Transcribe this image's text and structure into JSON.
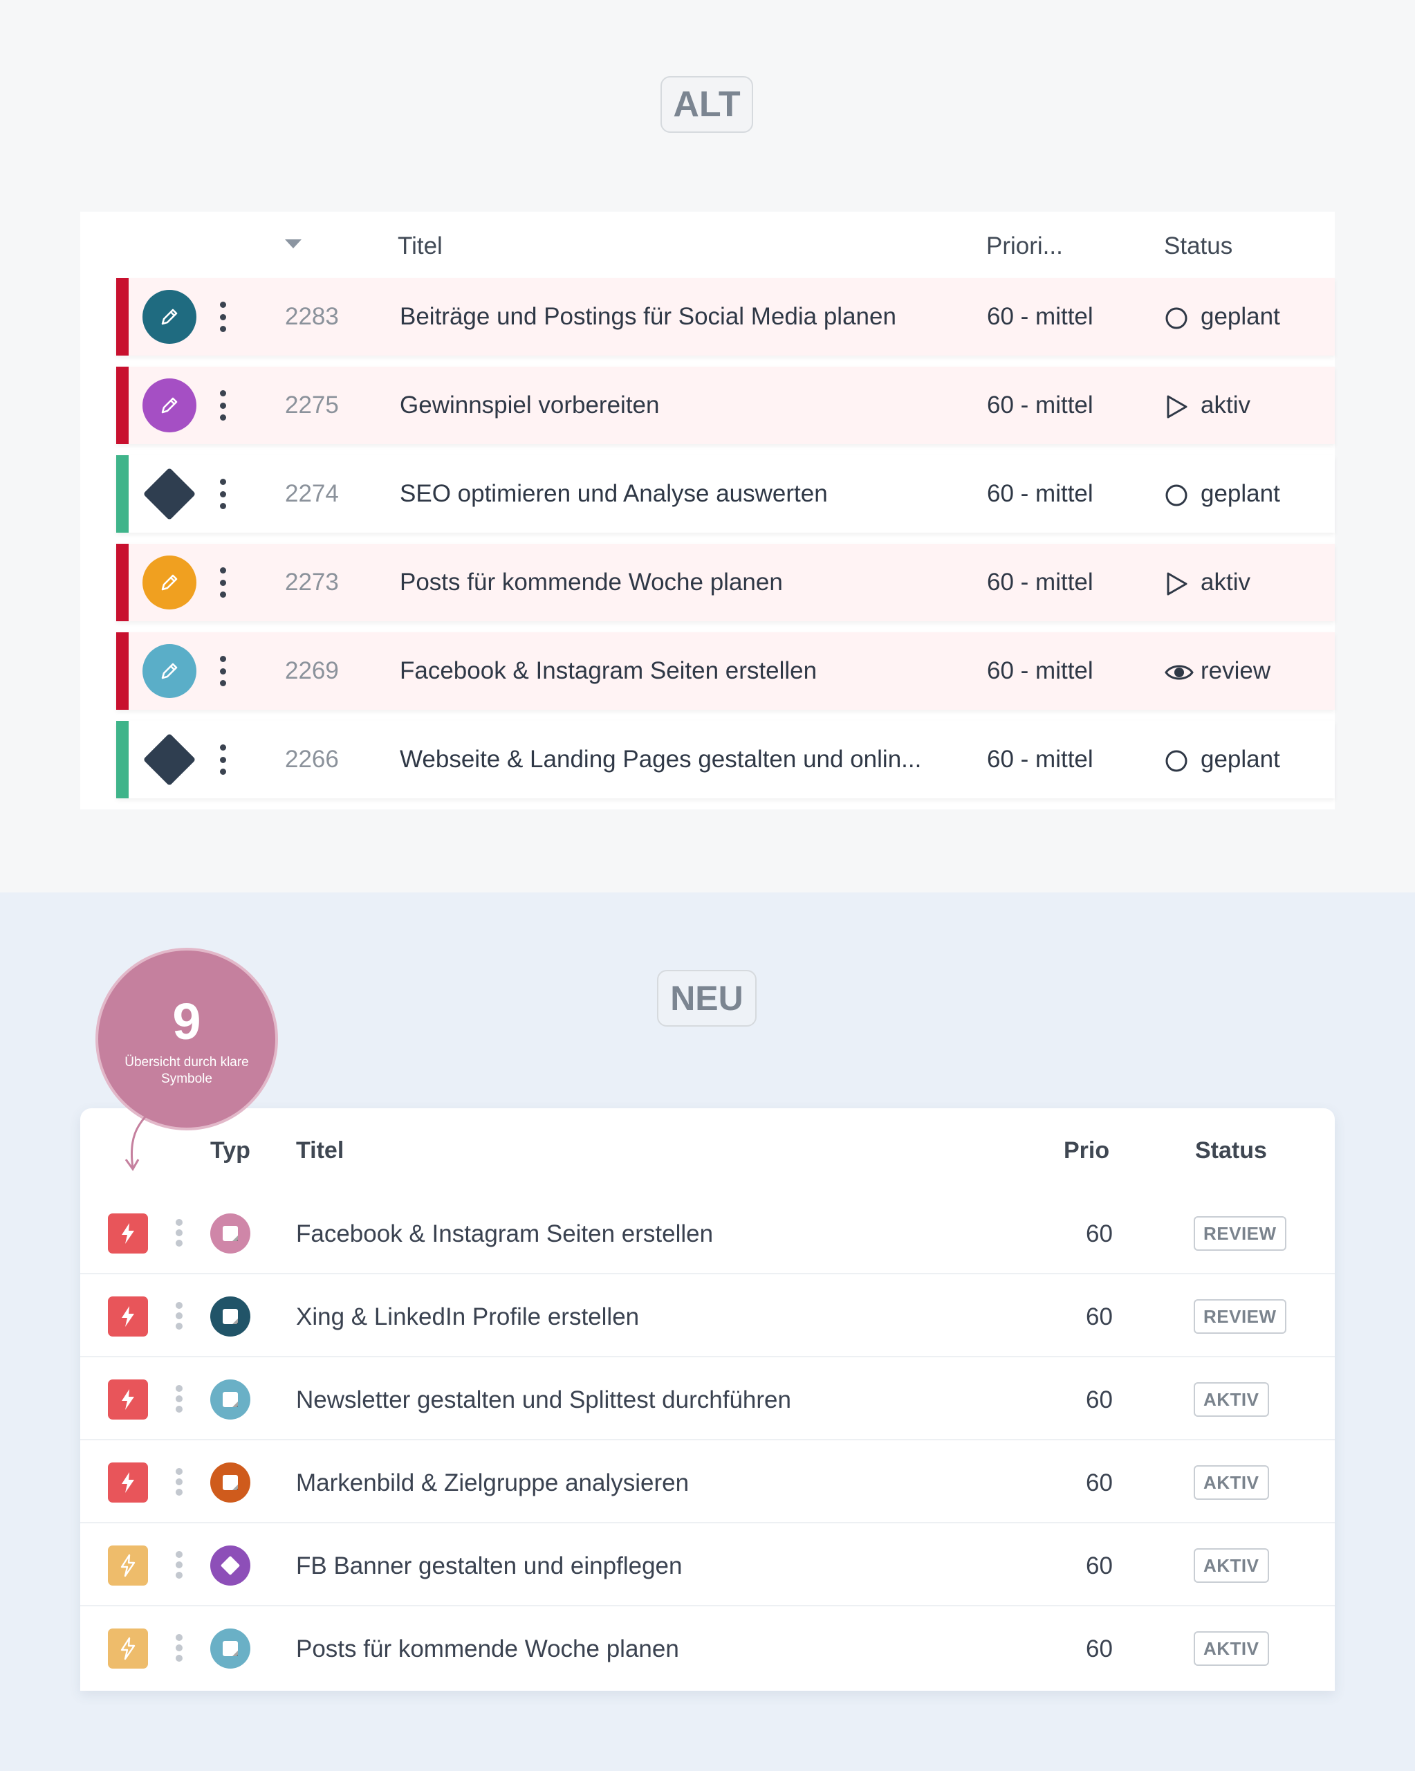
{
  "alt": {
    "badge": "ALT",
    "columns": {
      "title": "Titel",
      "priority": "Priori...",
      "status": "Status"
    },
    "rows": [
      {
        "id": "2283",
        "title": "Beiträge und Postings für Social Media planen",
        "priority": "60 - mittel",
        "status": "geplant",
        "status_icon": "circle-icon",
        "type_icon": "pencil-icon",
        "type_color": "#1f6b80",
        "stripe_color": "#c8102e",
        "highlight": true
      },
      {
        "id": "2275",
        "title": "Gewinnspiel vorbereiten",
        "priority": "60 - mittel",
        "status": "aktiv",
        "status_icon": "play-icon",
        "type_icon": "pencil-icon",
        "type_color": "#a54fc4",
        "stripe_color": "#c8102e",
        "highlight": true
      },
      {
        "id": "2274",
        "title": "SEO optimieren und Analyse auswerten",
        "priority": "60 - mittel",
        "status": "geplant",
        "status_icon": "circle-icon",
        "type_icon": "diamond-icon",
        "type_color": "#2f3e50",
        "stripe_color": "#3fb48a",
        "highlight": false
      },
      {
        "id": "2273",
        "title": "Posts für kommende Woche planen",
        "priority": "60 - mittel",
        "status": "aktiv",
        "status_icon": "play-icon",
        "type_icon": "pencil-icon",
        "type_color": "#f0a020",
        "stripe_color": "#c8102e",
        "highlight": true
      },
      {
        "id": "2269",
        "title": "Facebook & Instagram Seiten erstellen",
        "priority": "60 - mittel",
        "status": "review",
        "status_icon": "eye-icon",
        "type_icon": "pencil-icon",
        "type_color": "#5aaec8",
        "stripe_color": "#c8102e",
        "highlight": true
      },
      {
        "id": "2266",
        "title": "Webseite & Landing Pages gestalten und onlin...",
        "priority": "60 - mittel",
        "status": "geplant",
        "status_icon": "circle-icon",
        "type_icon": "diamond-icon",
        "type_color": "#2f3e50",
        "stripe_color": "#3fb48a",
        "highlight": false
      }
    ]
  },
  "neu": {
    "badge": "NEU",
    "callout": {
      "number": "9",
      "text": "Übersicht durch klare Symbole"
    },
    "columns": {
      "type": "Typ",
      "title": "Titel",
      "priority": "Prio",
      "status": "Status"
    },
    "rows": [
      {
        "title": "Facebook & Instagram Seiten erstellen",
        "priority": "60",
        "status": "REVIEW",
        "bolt_color": "#e8555a",
        "bolt_icon": "bolt-icon",
        "type_icon": "note-icon",
        "type_color": "#cf86a8"
      },
      {
        "title": "Xing & LinkedIn Profile erstellen",
        "priority": "60",
        "status": "REVIEW",
        "bolt_color": "#e8555a",
        "bolt_icon": "bolt-icon",
        "type_icon": "note-icon",
        "type_color": "#215468"
      },
      {
        "title": "Newsletter gestalten und Splittest durchführen",
        "priority": "60",
        "status": "AKTIV",
        "bolt_color": "#e8555a",
        "bolt_icon": "bolt-icon",
        "type_icon": "note-icon",
        "type_color": "#6ab0c6"
      },
      {
        "title": "Markenbild & Zielgruppe analysieren",
        "priority": "60",
        "status": "AKTIV",
        "bolt_color": "#e8555a",
        "bolt_icon": "bolt-icon",
        "type_icon": "note-icon",
        "type_color": "#cf5b1c"
      },
      {
        "title": "FB Banner gestalten und einpflegen",
        "priority": "60",
        "status": "AKTIV",
        "bolt_color": "#eebc6b",
        "bolt_icon": "bolt-outline-icon",
        "type_icon": "diamond-icon",
        "type_color": "#8d4fb8"
      },
      {
        "title": "Posts für kommende Woche planen",
        "priority": "60",
        "status": "AKTIV",
        "bolt_color": "#eebc6b",
        "bolt_icon": "bolt-outline-icon",
        "type_icon": "note-icon",
        "type_color": "#6ab0c6"
      }
    ]
  }
}
